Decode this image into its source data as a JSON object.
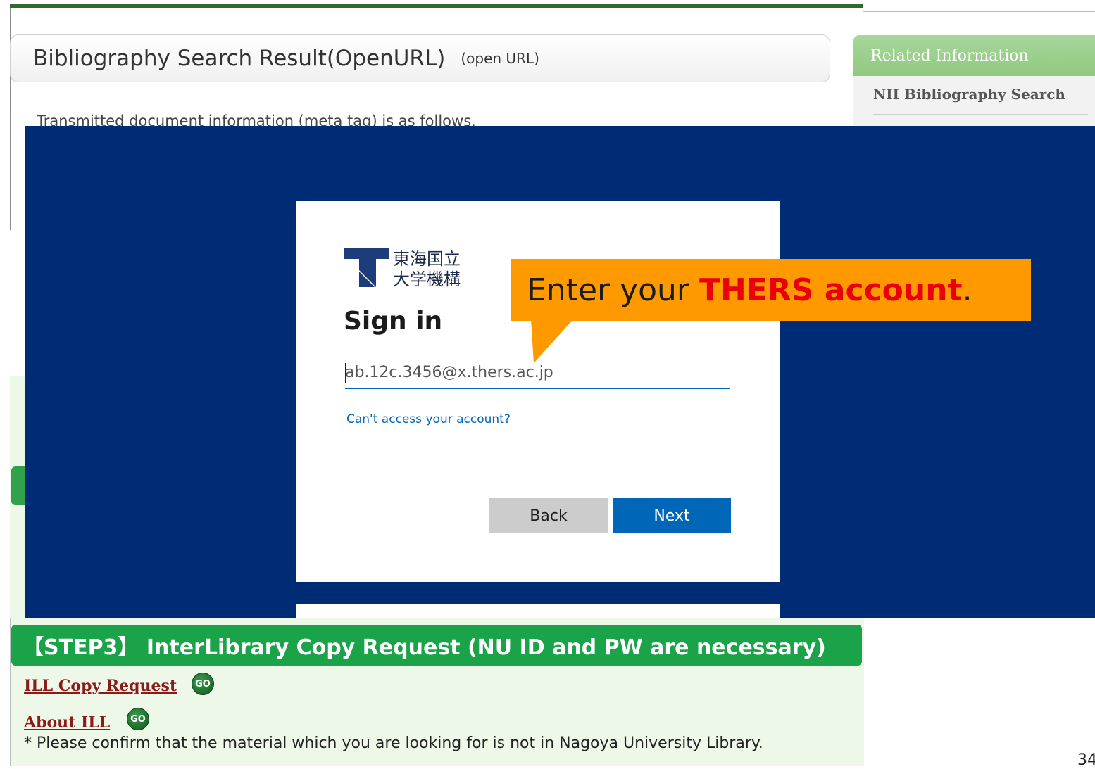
{
  "background_page": {
    "result_title": "Bibliography Search Result(OpenURL)",
    "result_subtitle": "(open URL)",
    "meta_text": "Transmitted document information (meta tag) is as follows.",
    "related": {
      "header": "Related Information",
      "link": "NII Bibliography Search"
    },
    "step3": {
      "title": "【STEP3】 InterLibrary Copy Request (NU ID and PW are necessary)",
      "links": [
        {
          "label": "ILL Copy Request",
          "go": "GO"
        },
        {
          "label": "About ILL",
          "go": "GO"
        }
      ],
      "note": "* Please confirm that the material which you are looking for is not in Nagoya University Library."
    }
  },
  "signin": {
    "org_name": "東海国立\n大学機構",
    "heading": "Sign in",
    "email_value": "ab.12c.3456@x.thers.ac.jp",
    "cant_access": "Can't access your account?",
    "back_label": "Back",
    "next_label": "Next"
  },
  "callout": {
    "prefix": "Enter your ",
    "emphasis": "THERS account",
    "suffix": "."
  },
  "page_number": "34",
  "colors": {
    "overlay": "#002b75",
    "accent_blue": "#0067b8",
    "step_green": "#1aa348",
    "callout_orange": "#ff9900",
    "callout_red": "#e8000b"
  }
}
